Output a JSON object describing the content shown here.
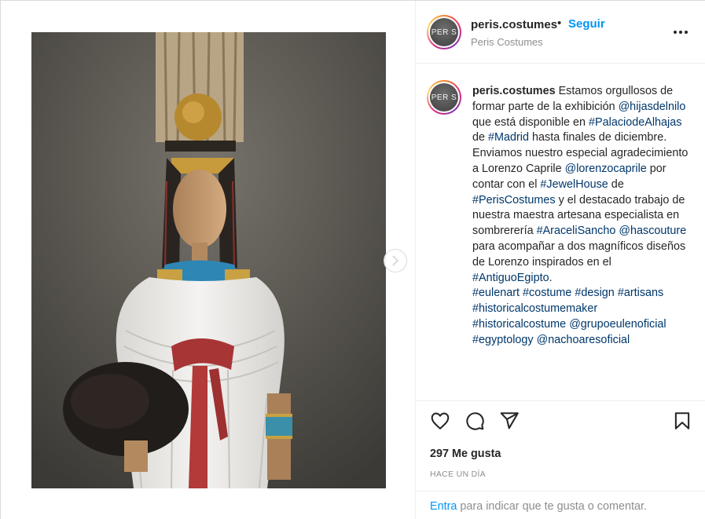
{
  "header": {
    "username": "peris.costumes",
    "separator": "•",
    "follow_label": "Seguir",
    "subtitle": "Peris Costumes",
    "avatar_text": "PER S"
  },
  "caption": {
    "username": "peris.costumes",
    "segments": [
      {
        "t": " Estamos orgullosos de formar parte de la exhibición "
      },
      {
        "t": "@hijasdelnilo",
        "link": true
      },
      {
        "t": " que está disponible en "
      },
      {
        "t": "#PalaciodeAlhajas",
        "link": true
      },
      {
        "t": " de "
      },
      {
        "t": "#Madrid",
        "link": true
      },
      {
        "t": " hasta finales de diciembre."
      },
      {
        "br": true
      },
      {
        "t": "Enviamos nuestro especial agradecimiento a Lorenzo Caprile "
      },
      {
        "t": "@lorenzocaprile",
        "link": true
      },
      {
        "t": " por contar con el "
      },
      {
        "t": "#JewelHouse",
        "link": true
      },
      {
        "t": " de "
      },
      {
        "t": "#PerisCostumes",
        "link": true
      },
      {
        "t": " y el destacado trabajo de nuestra maestra artesana especialista en sombrerería "
      },
      {
        "t": "#AraceliSancho",
        "link": true
      },
      {
        "t": " "
      },
      {
        "t": "@hascouture",
        "link": true
      },
      {
        "t": " para acompañar a dos magníficos diseños de Lorenzo inspirados en el "
      },
      {
        "t": "#AntiguoEgipto",
        "link": true
      },
      {
        "t": "."
      },
      {
        "br": true
      },
      {
        "t": "#eulenart",
        "link": true
      },
      {
        "t": " "
      },
      {
        "t": "#costume",
        "link": true
      },
      {
        "t": " "
      },
      {
        "t": "#design",
        "link": true
      },
      {
        "t": " "
      },
      {
        "t": "#artisans",
        "link": true
      },
      {
        "t": " "
      },
      {
        "t": "#historicalcostumemaker",
        "link": true
      },
      {
        "t": " "
      },
      {
        "t": "#historicalcostume",
        "link": true
      },
      {
        "t": " "
      },
      {
        "t": "@grupoeulenoficial",
        "link": true
      },
      {
        "t": " "
      },
      {
        "t": "#egyptology",
        "link": true
      },
      {
        "t": " "
      },
      {
        "t": "@nachoaresoficial",
        "link": true
      }
    ]
  },
  "actions": [
    "heart-icon",
    "comment-icon",
    "share-icon",
    "bookmark-icon"
  ],
  "likes": "297 Me gusta",
  "date": "HACE UN DÍA",
  "footer": {
    "login_label": "Entra",
    "rest": " para indicar que te gusta o comentar."
  },
  "colors": {
    "accent": "#0095f6",
    "link": "#00376b",
    "muted": "#8e8e8e"
  }
}
